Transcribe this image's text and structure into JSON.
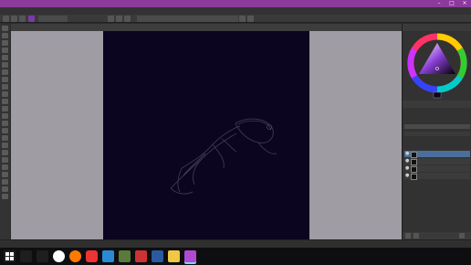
{
  "window": {
    "title": ""
  },
  "menubar": [],
  "toolbar": {
    "blend_mode": "",
    "opacity_label": "",
    "size_label": ""
  },
  "document": {
    "tab_label": ""
  },
  "right_panel": {
    "layers_header": "",
    "layers_tab_label": "",
    "layers": []
  },
  "statusbar": {
    "brush": "",
    "color_profile": "",
    "dimensions": "",
    "zoom": ""
  },
  "taskbar": {
    "time": "",
    "date": ""
  },
  "watermark": "",
  "colors": {
    "titlebar": "#8c3a9c",
    "canvas": "#0b0520",
    "workarea": "#a09ca4",
    "selected_layer": "#4a6f9c"
  }
}
